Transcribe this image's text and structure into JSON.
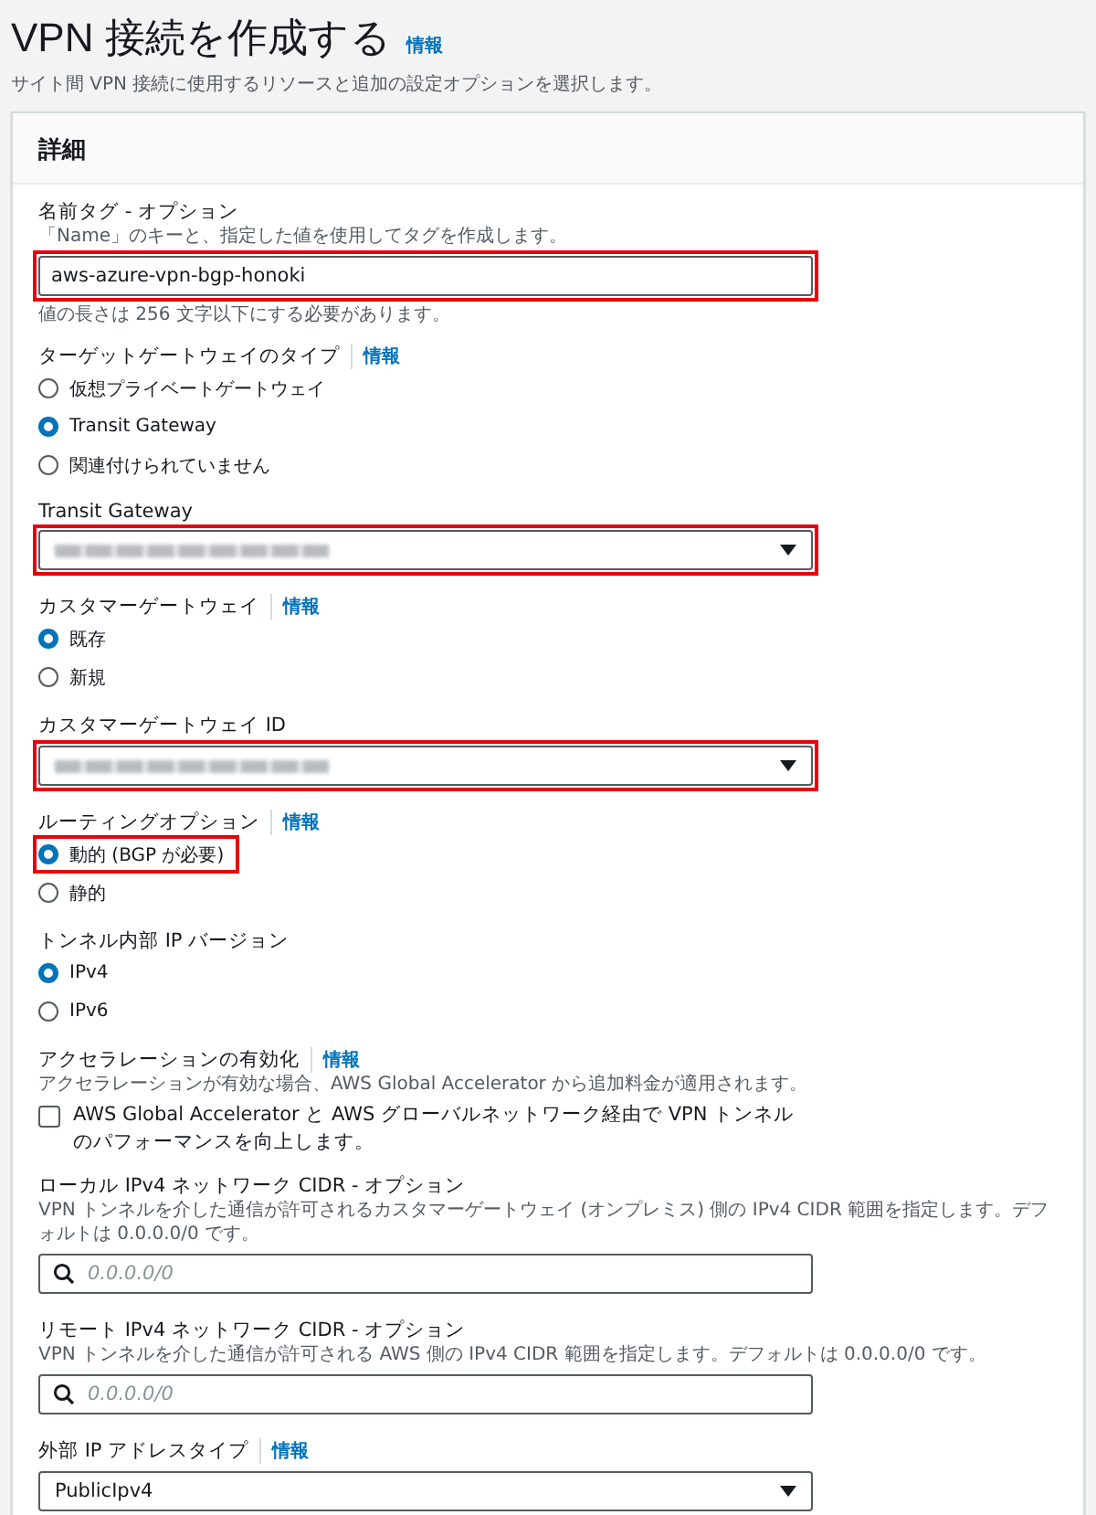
{
  "page": {
    "title": "VPN 接続を作成する",
    "info_link": "情報",
    "description": "サイト間 VPN 接続に使用するリソースと追加の設定オプションを選択します。"
  },
  "panel": {
    "title": "詳細"
  },
  "fields": [
    {
      "kind": "text",
      "label": "名前タグ - オプション",
      "description": "「Name」のキーと、指定した値を使用してタグを作成します。",
      "value": "aws-azure-vpn-bgp-honoki",
      "constraint": "値の長さは 256 文字以下にする必要があります。",
      "highlighted": true
    },
    {
      "kind": "radio",
      "label": "ターゲットゲートウェイのタイプ",
      "info": "情報",
      "options": [
        {
          "label": "仮想プライベートゲートウェイ",
          "selected": false,
          "highlighted": false
        },
        {
          "label": "Transit Gateway",
          "selected": true,
          "highlighted": false
        },
        {
          "label": "関連付けられていません",
          "selected": false,
          "highlighted": false
        }
      ]
    },
    {
      "kind": "select",
      "label": "Transit Gateway",
      "redacted": true,
      "highlighted": true
    },
    {
      "kind": "radio",
      "label": "カスタマーゲートウェイ",
      "info": "情報",
      "options": [
        {
          "label": "既存",
          "selected": true,
          "highlighted": false
        },
        {
          "label": "新規",
          "selected": false,
          "highlighted": false
        }
      ]
    },
    {
      "kind": "select",
      "label": "カスタマーゲートウェイ ID",
      "redacted": true,
      "highlighted": true
    },
    {
      "kind": "radio",
      "label": "ルーティングオプション",
      "info": "情報",
      "options": [
        {
          "label": "動的 (BGP が必要)",
          "selected": true,
          "highlighted": true
        },
        {
          "label": "静的",
          "selected": false,
          "highlighted": false
        }
      ]
    },
    {
      "kind": "radio",
      "label": "トンネル内部 IP バージョン",
      "options": [
        {
          "label": "IPv4",
          "selected": true,
          "highlighted": false
        },
        {
          "label": "IPv6",
          "selected": false,
          "highlighted": false
        }
      ]
    },
    {
      "kind": "checkbox",
      "label": "アクセラレーションの有効化",
      "info": "情報",
      "description": "アクセラレーションが有効な場合、AWS Global Accelerator から追加料金が適用されます。",
      "checkbox": {
        "label": "AWS Global Accelerator と AWS グローバルネットワーク経由で VPN トンネルのパフォーマンスを向上します。",
        "checked": false
      }
    },
    {
      "kind": "search",
      "label": "ローカル IPv4 ネットワーク CIDR - オプション",
      "description": "VPN トンネルを介した通信が許可されるカスタマーゲートウェイ (オンプレミス) 側の IPv4 CIDR 範囲を指定します。デフォルトは 0.0.0.0/0 です。",
      "placeholder": "0.0.0.0/0"
    },
    {
      "kind": "search",
      "label": "リモート IPv4 ネットワーク CIDR - オプション",
      "description": "VPN トンネルを介した通信が許可される AWS 側の IPv4 CIDR 範囲を指定します。デフォルトは 0.0.0.0/0 です。",
      "placeholder": "0.0.0.0/0"
    },
    {
      "kind": "select",
      "label": "外部 IP アドレスタイプ",
      "info": "情報",
      "value": "PublicIpv4",
      "highlighted": false
    }
  ]
}
